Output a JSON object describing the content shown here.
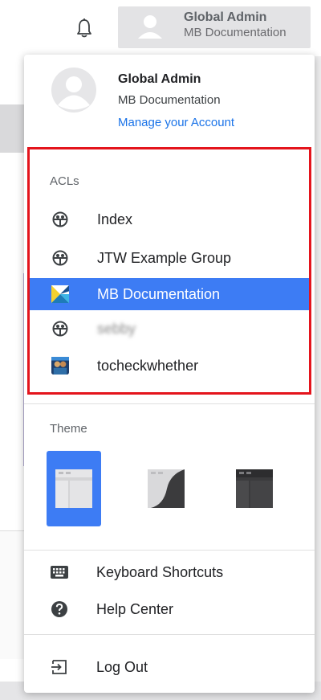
{
  "header": {
    "account_name": "Global Admin",
    "account_org": "MB Documentation"
  },
  "menu": {
    "profile": {
      "name": "Global Admin",
      "org": "MB Documentation",
      "manage_link": "Manage your Account"
    },
    "acl_section_label": "ACLs",
    "acls": [
      {
        "label": "Index",
        "icon": "acl-group-icon"
      },
      {
        "label": "JTW Example Group",
        "icon": "acl-group-icon"
      },
      {
        "label": "MB Documentation",
        "icon": "mb-logo-icon",
        "selected": true
      },
      {
        "label": "sebby",
        "icon": "acl-group-icon"
      },
      {
        "label": "tocheckwhether",
        "icon": "user-photo-icon"
      }
    ],
    "theme_label": "Theme",
    "themes": [
      "light",
      "auto",
      "dark"
    ],
    "active_theme": "light",
    "items": [
      {
        "label": "Keyboard Shortcuts",
        "icon": "keyboard-icon"
      },
      {
        "label": "Help Center",
        "icon": "help-icon"
      },
      {
        "label": "Log Out",
        "icon": "logout-icon"
      }
    ]
  },
  "colors": {
    "accent": "#3d7cf4",
    "highlight_border": "#e4141c",
    "link": "#1a73e8"
  }
}
